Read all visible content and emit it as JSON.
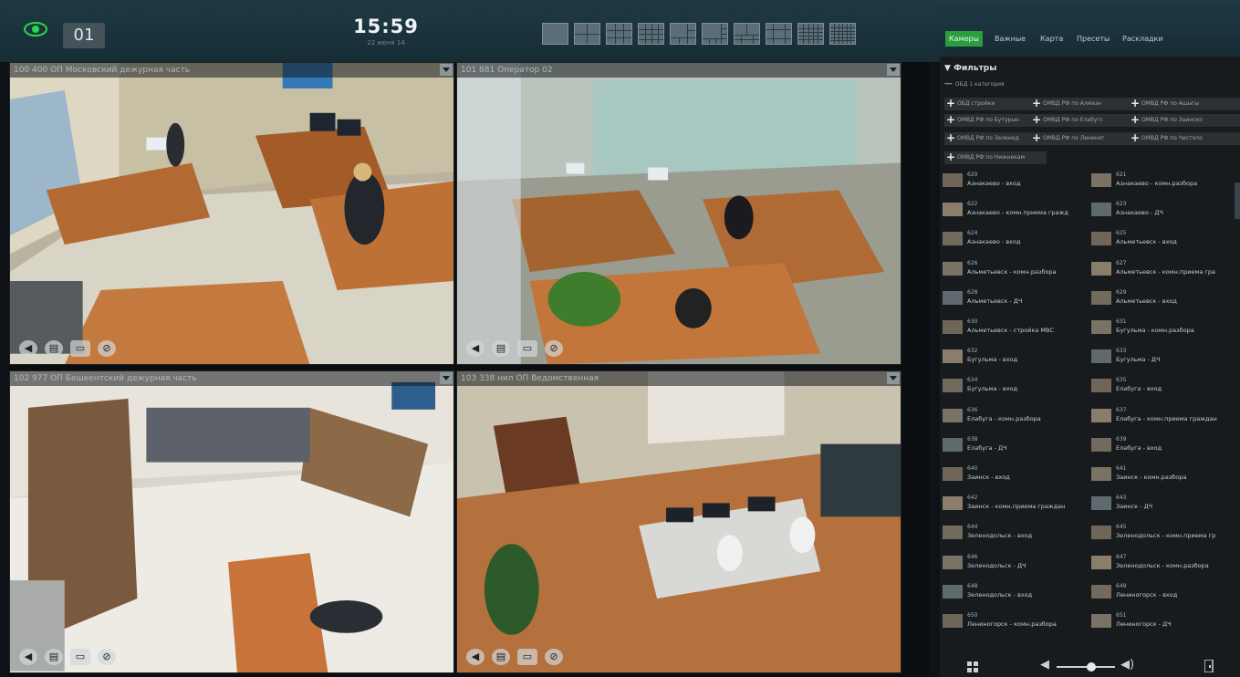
{
  "topbar": {
    "monitor": "01",
    "time": "15:59",
    "date": "22 июня 14",
    "layouts": [
      "layout-1x1",
      "layout-2x2",
      "layout-3x3",
      "layout-4x4",
      "layout-1+5",
      "layout-1+7",
      "layout-2+8",
      "layout-1+12",
      "layout-5x5",
      "layout-6x6"
    ]
  },
  "cameras": [
    {
      "title": "100  400  ОП Московский дежурная часть"
    },
    {
      "title": "101  881  Оператор 02"
    },
    {
      "title": "102  977  ОП Бешкентский дежурная часть"
    },
    {
      "title": "103  338  нил ОП Ведомственная"
    }
  ],
  "panel": {
    "tabs": [
      "Камеры",
      "Важные",
      "Карта",
      "Пресеты",
      "Раскладки"
    ],
    "filters_label": "Фильтры",
    "category_line": "ОБД 1 категория",
    "filter_buttons": [
      "ОБД стройки",
      "ОМВД РФ по Алмазн",
      "ОМВД РФ по Ашыгы",
      "ОМВД РФ по Бутурын",
      "ОМВД РФ по Елабугс",
      "ОМВД РФ по Заинско",
      "ОМВД РФ по Зеленод",
      "ОМВД РФ по Лениног",
      "ОМВД РФ по Чистопо",
      "ОМВД РФ по Нижнекам"
    ],
    "camera_list": [
      {
        "num": "620",
        "name": "Азнакаево - вход"
      },
      {
        "num": "621",
        "name": "Азнакаево - комн.разбора"
      },
      {
        "num": "622",
        "name": "Азнакаево - комн.приема гражд"
      },
      {
        "num": "623",
        "name": "Азнакаево - ДЧ"
      },
      {
        "num": "624",
        "name": "Азнакаево - вход"
      },
      {
        "num": "625",
        "name": "Альметьевск - вход"
      },
      {
        "num": "626",
        "name": "Альметьевск - комн.разбора"
      },
      {
        "num": "627",
        "name": "Альметьевск - комн.приема гра"
      },
      {
        "num": "628",
        "name": "Альметьевск - ДЧ"
      },
      {
        "num": "629",
        "name": "Альметьевск - вход"
      },
      {
        "num": "630",
        "name": "Альметьевск - стройка МВС"
      },
      {
        "num": "631",
        "name": "Бугульма - комн.разбора"
      },
      {
        "num": "632",
        "name": "Бугульма - вход"
      },
      {
        "num": "633",
        "name": "Бугульма - ДЧ"
      },
      {
        "num": "634",
        "name": "Бугульма - вход"
      },
      {
        "num": "635",
        "name": "Елабуга - вход"
      },
      {
        "num": "636",
        "name": "Елабуга - комн.разбора"
      },
      {
        "num": "637",
        "name": "Елабуга - комн.приема граждан"
      },
      {
        "num": "638",
        "name": "Елабуга - ДЧ"
      },
      {
        "num": "639",
        "name": "Елабуга - вход"
      },
      {
        "num": "640",
        "name": "Заинск - вход"
      },
      {
        "num": "641",
        "name": "Заинск - комн.разбора"
      },
      {
        "num": "642",
        "name": "Заинск - комн.приема граждан"
      },
      {
        "num": "643",
        "name": "Заинск - ДЧ"
      },
      {
        "num": "644",
        "name": "Зеленодольск - вход"
      },
      {
        "num": "645",
        "name": "Зеленодольск - комн.приема гр"
      },
      {
        "num": "646",
        "name": "Зеленодольск - ДЧ"
      },
      {
        "num": "647",
        "name": "Зеленодольск - комн.разбора"
      },
      {
        "num": "648",
        "name": "Зеленодольск - вход"
      },
      {
        "num": "649",
        "name": "Лениногорск - вход"
      },
      {
        "num": "650",
        "name": "Лениногорск - комн.разбора"
      },
      {
        "num": "651",
        "name": "Лениногорск - ДЧ"
      }
    ],
    "volume": 0.6
  }
}
